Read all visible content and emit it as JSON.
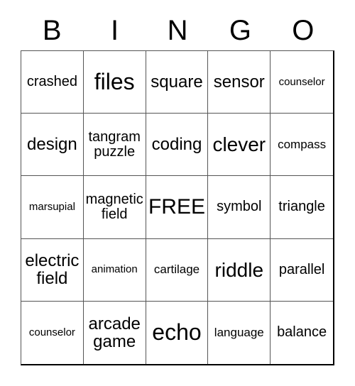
{
  "card": {
    "title": "BINGO",
    "header_letters": [
      "B",
      "I",
      "N",
      "G",
      "O"
    ],
    "free_space_label": "FREE",
    "grid_size": "5x5",
    "border_color": "#000000",
    "text_color": "#000000",
    "background_color": "#ffffff",
    "rows": [
      [
        {
          "text": "crashed",
          "size": "fs-med"
        },
        {
          "text": "files",
          "size": "fs-xxl"
        },
        {
          "text": "square",
          "size": "fs-lg"
        },
        {
          "text": "sensor",
          "size": "fs-lg"
        },
        {
          "text": "counselor",
          "size": "fs-xs"
        }
      ],
      [
        {
          "text": "design",
          "size": "fs-lg"
        },
        {
          "text": "tangram puzzle",
          "size": "fs-med"
        },
        {
          "text": "coding",
          "size": "fs-lg"
        },
        {
          "text": "clever",
          "size": "fs-xl"
        },
        {
          "text": "compass",
          "size": "fs-sm"
        }
      ],
      [
        {
          "text": "marsupial",
          "size": "fs-xs"
        },
        {
          "text": "magnetic field",
          "size": "fs-med"
        },
        {
          "text": "FREE",
          "size": "fs-free"
        },
        {
          "text": "symbol",
          "size": "fs-med"
        },
        {
          "text": "triangle",
          "size": "fs-med"
        }
      ],
      [
        {
          "text": "electric field",
          "size": "fs-lg"
        },
        {
          "text": "animation",
          "size": "fs-xs"
        },
        {
          "text": "cartilage",
          "size": "fs-sm"
        },
        {
          "text": "riddle",
          "size": "fs-xl"
        },
        {
          "text": "parallel",
          "size": "fs-med"
        }
      ],
      [
        {
          "text": "counselor",
          "size": "fs-xs"
        },
        {
          "text": "arcade game",
          "size": "fs-lg"
        },
        {
          "text": "echo",
          "size": "fs-xxl"
        },
        {
          "text": "language",
          "size": "fs-sm"
        },
        {
          "text": "balance",
          "size": "fs-med"
        }
      ]
    ]
  }
}
